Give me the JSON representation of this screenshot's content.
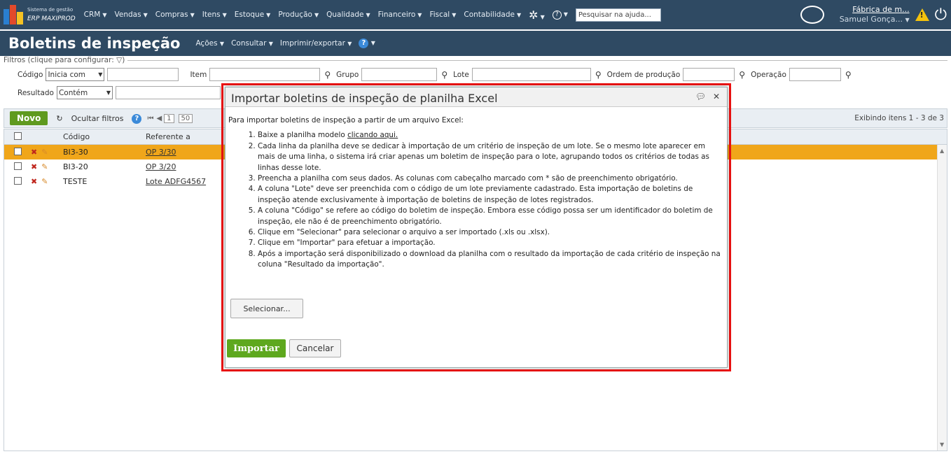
{
  "header": {
    "logo_small": "Sistema de gestão",
    "logo_big": "ERP MAXIPROD",
    "menu": [
      "CRM",
      "Vendas",
      "Compras",
      "Itens",
      "Estoque",
      "Produção",
      "Qualidade",
      "Financeiro",
      "Fiscal",
      "Contabilidade"
    ],
    "help_search_value": "Pesquisar na ajuda...",
    "company": "Fábrica de m...",
    "user": "Samuel Gonça..."
  },
  "page": {
    "title": "Boletins de inspeção",
    "menus": [
      "Ações",
      "Consultar",
      "Imprimir/exportar"
    ]
  },
  "filters": {
    "legend": "Filtros (clique para configurar:",
    "codigo_label": "Código",
    "codigo_mode": "Inicia com",
    "item_label": "Item",
    "grupo_label": "Grupo",
    "lote_label": "Lote",
    "ordem_label": "Ordem de produção",
    "operacao_label": "Operação",
    "resultado_label": "Resultado",
    "resultado_mode": "Contém"
  },
  "toolbar": {
    "novo": "Novo",
    "ocultar": "Ocultar filtros",
    "page": "1",
    "page_size": "50",
    "display_info": "Exibindo itens 1 - 3 de 3"
  },
  "grid": {
    "headers": [
      "Código",
      "Referente a"
    ],
    "rows": [
      {
        "code": "BI3-30",
        "ref": "OP 3/30"
      },
      {
        "code": "BI3-20",
        "ref": "OP 3/20"
      },
      {
        "code": "TESTE",
        "ref": "Lote ADFG4567"
      }
    ]
  },
  "modal": {
    "title": "Importar boletins de inspeção de planilha Excel",
    "intro": "Para importar boletins de inspeção a partir de um arquivo Excel:",
    "step1_text": "Baixe a planilha modelo ",
    "step1_link": "clicando aqui.",
    "steps": [
      "Cada linha da planilha deve se dedicar à importação de um critério de inspeção de um lote. Se o mesmo lote aparecer em mais de uma linha, o sistema irá criar apenas um boletim de inspeção para o lote, agrupando todos os critérios de todas as linhas desse lote.",
      "Preencha a planilha com seus dados. As colunas com cabeçalho marcado com * são de preenchimento obrigatório.",
      "A coluna \"Lote\" deve ser preenchida com o código de um lote previamente cadastrado. Esta importação de boletins de inspeção atende exclusivamente à importação de boletins de inspeção de lotes registrados.",
      "A coluna \"Código\" se refere ao código do boletim de inspeção. Embora esse código possa ser um identificador do boletim de inspeção, ele não é de preenchimento obrigatório.",
      "Clique em \"Selecionar\" para selecionar o arquivo a ser importado (.xls ou .xlsx).",
      "Clique em \"Importar\" para efetuar a importação.",
      "Após a importação será disponibilizado o download da planilha com o resultado da importação de cada critério de inspeção na coluna \"Resultado da importação\"."
    ],
    "select_button": "Selecionar...",
    "import_button": "Importar",
    "cancel_button": "Cancelar"
  },
  "colors": {
    "nav_bg": "#2f4a63",
    "accent_green": "#5ea81e",
    "selected_row": "#f0a61a",
    "highlight_border": "#ee1111"
  }
}
